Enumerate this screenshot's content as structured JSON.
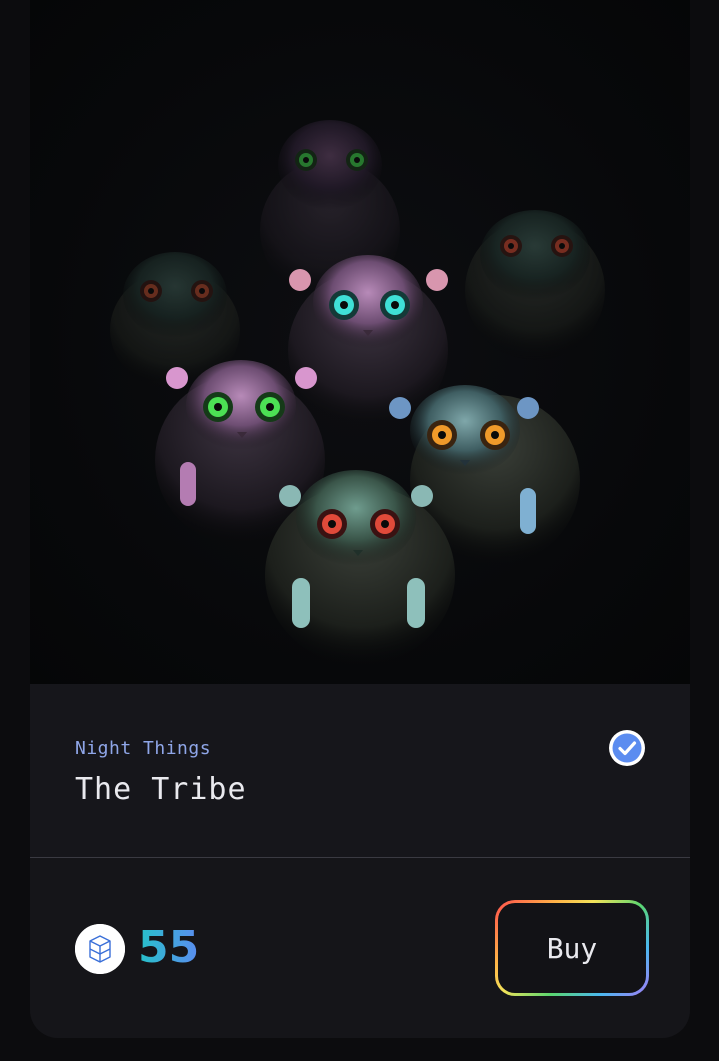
{
  "nft": {
    "collection": "Night Things",
    "title": "The Tribe",
    "verified": true,
    "verified_icon": "verified-check-icon",
    "artwork_icon": "nft-artwork"
  },
  "price": {
    "token_icon": "fantom-token-icon",
    "amount": "55"
  },
  "actions": {
    "buy_label": "Buy"
  },
  "colors": {
    "background": "#0c0c0e",
    "card": "#141418",
    "collection_text": "#8fa6e8",
    "title_text": "#e9e9ee",
    "price_gradient_start": "#26c2c9",
    "price_gradient_end": "#5b8cf0",
    "verified_blue": "#5b8cf0"
  }
}
